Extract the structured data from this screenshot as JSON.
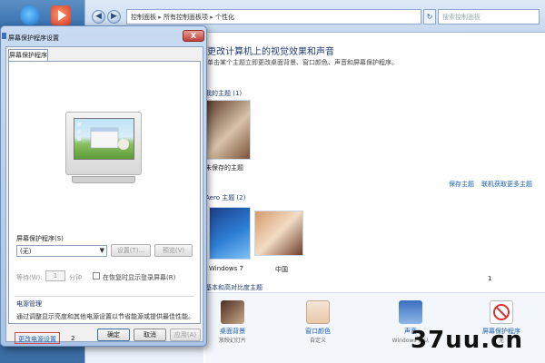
{
  "address": {
    "parts": [
      "控制面板",
      "所有控制面板项",
      "个性化"
    ],
    "separator": "▸"
  },
  "search": {
    "placeholder": "搜索控制面板"
  },
  "main": {
    "title": "更改计算机上的视觉效果和声音",
    "subtitle": "单击某个主题立即更改桌面背景、窗口颜色、声音和屏幕保护程序。",
    "my_themes": "我的主题 (1)",
    "unsaved_theme": "未保存的主题",
    "save_theme": "保存主题",
    "get_more_themes": "联机获取更多主题",
    "aero_themes": "Aero 主题 (2)",
    "theme_windows7": "Windows 7",
    "theme_china": "中国",
    "basic_themes": "基本和高对比度主题",
    "counter_1": "1",
    "bottom": [
      {
        "label": "桌面背景",
        "sub": "放映幻灯片"
      },
      {
        "label": "窗口颜色",
        "sub": "自定义"
      },
      {
        "label": "声音",
        "sub": "Windows 默认"
      },
      {
        "label": "屏幕保护程序",
        "sub": "无"
      }
    ]
  },
  "dialog": {
    "title": "屏幕保护程序设置",
    "close": "X",
    "tab": "屏幕保护程序",
    "screensaver_label": "屏幕保护程序(S)",
    "screensaver_value": "(无)",
    "settings_button": "设置(T)...",
    "preview_button": "预览(V)",
    "wait_label": "等待(W):",
    "wait_value": "1",
    "wait_unit": "分钟",
    "resume_checkbox_label": "在恢复时显示登录屏幕(R)",
    "power_title": "电源管理",
    "power_desc": "通过调整显示亮度和其他电源设置以节省能源或提供最佳性能。",
    "change_power_link": "更改电源设置",
    "counter_2": "2",
    "ok": "确定",
    "cancel": "取消",
    "apply": "应用(A)"
  },
  "watermark": "37uu.cn",
  "colors": {
    "accent_link": "#1a5fb4",
    "highlight_border": "#d14a48",
    "title_blue": "#1e3a6e"
  }
}
